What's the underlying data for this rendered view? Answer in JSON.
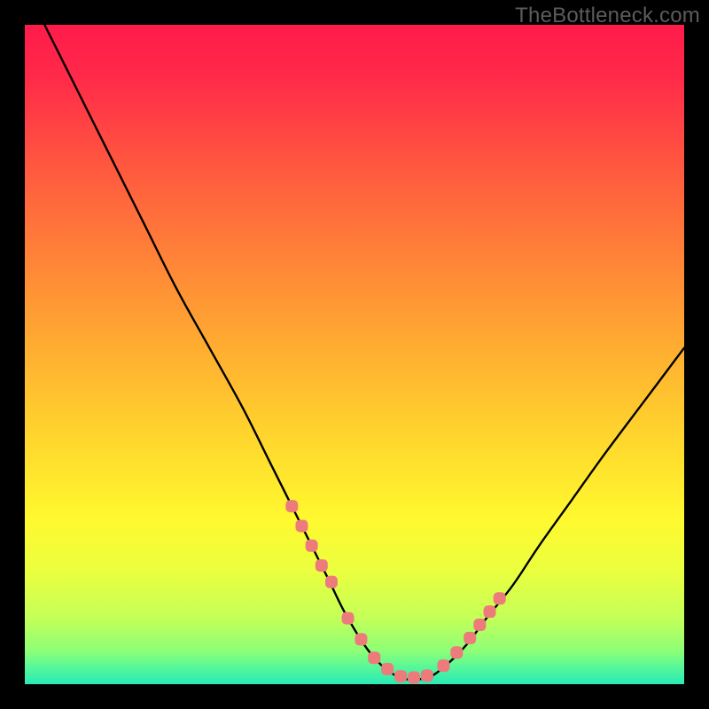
{
  "watermark": {
    "text": "TheBottleneck.com"
  },
  "chart_data": {
    "type": "line",
    "title": "",
    "xlabel": "",
    "ylabel": "",
    "xlim": [
      0,
      100
    ],
    "ylim": [
      0,
      100
    ],
    "grid": false,
    "gradient_stops": [
      {
        "offset": 0.0,
        "color": "#ff1b4b"
      },
      {
        "offset": 0.08,
        "color": "#ff2a49"
      },
      {
        "offset": 0.2,
        "color": "#ff5340"
      },
      {
        "offset": 0.35,
        "color": "#ff8238"
      },
      {
        "offset": 0.5,
        "color": "#ffb030"
      },
      {
        "offset": 0.65,
        "color": "#ffdd2d"
      },
      {
        "offset": 0.75,
        "color": "#fff92f"
      },
      {
        "offset": 0.83,
        "color": "#eaff3f"
      },
      {
        "offset": 0.9,
        "color": "#c4ff58"
      },
      {
        "offset": 0.95,
        "color": "#8cff77"
      },
      {
        "offset": 0.975,
        "color": "#55f79a"
      },
      {
        "offset": 1.0,
        "color": "#29eab7"
      }
    ],
    "series": [
      {
        "name": "bottleneck-curve",
        "color": "#000000",
        "x": [
          3,
          8,
          13,
          18,
          23,
          28,
          33,
          37,
          40,
          43,
          46,
          49,
          53,
          57,
          61,
          64,
          67,
          70,
          74,
          78,
          83,
          88,
          94,
          100
        ],
        "values": [
          100,
          90,
          80,
          70,
          60,
          51,
          42,
          34,
          28,
          22,
          16,
          10,
          4,
          1,
          1,
          3,
          6,
          10,
          15,
          21,
          28,
          35,
          43,
          51
        ]
      }
    ],
    "markers": {
      "name": "highlighted-points",
      "color": "#ed7b7b",
      "x": [
        40.5,
        42.0,
        43.5,
        45.0,
        46.5,
        49.0,
        51.0,
        53.0,
        55.0,
        57.0,
        59.0,
        61.0,
        63.5,
        65.5,
        67.5,
        69.0,
        70.5,
        72.0
      ],
      "values": [
        27.0,
        24.0,
        21.0,
        18.0,
        15.5,
        10.0,
        6.8,
        4.0,
        2.3,
        1.2,
        1.0,
        1.3,
        2.8,
        4.8,
        7.0,
        9.0,
        11.0,
        13.0
      ]
    }
  }
}
